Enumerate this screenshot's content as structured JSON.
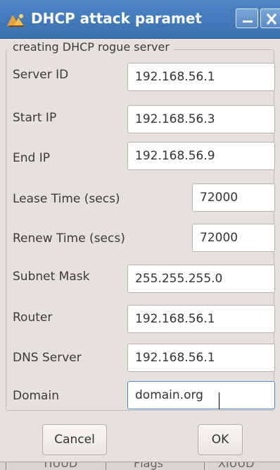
{
  "window": {
    "title": "DHCP attack paramet",
    "app_icon": "dhcp-attack-icon",
    "buttons": [
      "minimize-icon",
      "close-icon"
    ]
  },
  "group": {
    "title": "creating DHCP rogue server"
  },
  "fields": [
    {
      "label": "Server ID",
      "value": "192.168.56.1"
    },
    {
      "label": "Start IP",
      "value": "192.168.56.3"
    },
    {
      "label": "End IP",
      "value": "192.168.56.9"
    },
    {
      "label": "Lease Time (secs)",
      "value": "72000"
    },
    {
      "label": "Renew Time (secs)",
      "value": "72000"
    },
    {
      "label": "Subnet Mask",
      "value": "255.255.255.0"
    },
    {
      "label": "Router",
      "value": "192.168.56.1"
    },
    {
      "label": "DNS Server",
      "value": "192.168.56.1"
    },
    {
      "label": "Domain",
      "value": "domain.org"
    }
  ],
  "actions": {
    "cancel_label": "Cancel",
    "ok_label": "OK"
  },
  "background_columns": [
    "TIUUD",
    "Flags",
    "XIUUD"
  ],
  "colors": {
    "titlebar": "#3a6fb0",
    "dialog_bg": "#e6e1dc",
    "focus_border": "#4d86c8"
  }
}
